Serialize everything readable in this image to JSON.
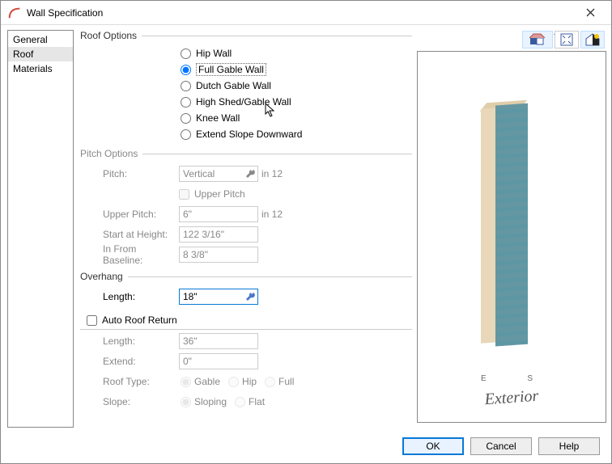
{
  "window": {
    "title": "Wall Specification"
  },
  "nav": {
    "items": [
      "General",
      "Roof",
      "Materials"
    ],
    "selected": 1
  },
  "roof_options": {
    "legend": "Roof Options",
    "choices": [
      "Hip Wall",
      "Full Gable Wall",
      "Dutch Gable Wall",
      "High Shed/Gable Wall",
      "Knee Wall",
      "Extend Slope Downward"
    ],
    "selected": 1
  },
  "pitch_options": {
    "legend": "Pitch Options",
    "pitch_label": "Pitch:",
    "pitch_value": "Vertical",
    "pitch_unit": "in 12",
    "upper_chk_label": "Upper Pitch",
    "upper_checked": false,
    "upper_pitch_label": "Upper Pitch:",
    "upper_pitch_value": "6\"",
    "upper_pitch_unit": "in 12",
    "start_label": "Start at Height:",
    "start_value": "122 3/16\"",
    "baseline_label": "In From Baseline:",
    "baseline_value": "8 3/8\""
  },
  "overhang": {
    "legend": "Overhang",
    "length_label": "Length:",
    "length_value": "18\""
  },
  "auto_return": {
    "chk_label": "Auto Roof Return",
    "checked": false,
    "length_label": "Length:",
    "length_value": "36\"",
    "extend_label": "Extend:",
    "extend_value": "0\"",
    "rooftype_label": "Roof Type:",
    "rooftype_opts": [
      "Gable",
      "Hip",
      "Full"
    ],
    "slope_label": "Slope:",
    "slope_opts": [
      "Sloping",
      "Flat"
    ]
  },
  "preview": {
    "axis": "E     S",
    "label": "Exterior"
  },
  "footer": {
    "ok": "OK",
    "cancel": "Cancel",
    "help": "Help"
  }
}
